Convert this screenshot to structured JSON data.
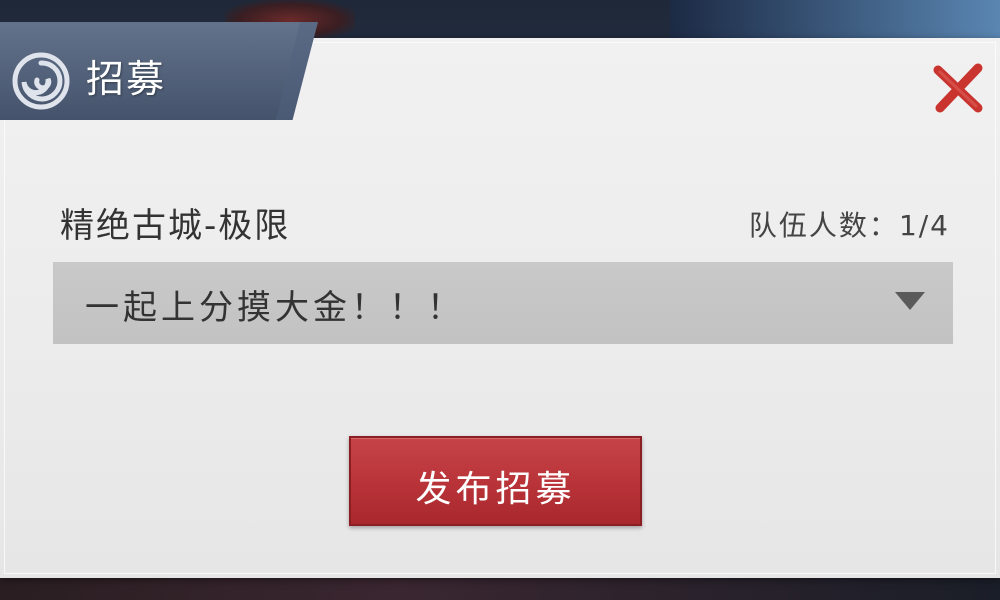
{
  "dialog": {
    "title": "招募",
    "dungeon_name": "精绝古城-极限",
    "team_count_label": "队伍人数：",
    "team_count_value": "1/4",
    "message": "一起上分摸大金！！！",
    "publish_button": "发布招募"
  },
  "icons": {
    "title_icon": "spiral-icon",
    "close": "close-icon",
    "dropdown": "triangle-down-icon"
  },
  "colors": {
    "accent_red": "#b83338",
    "tab_bg": "#4f5f79",
    "panel_bg": "#ececec",
    "select_bg": "#c6c6c6"
  }
}
